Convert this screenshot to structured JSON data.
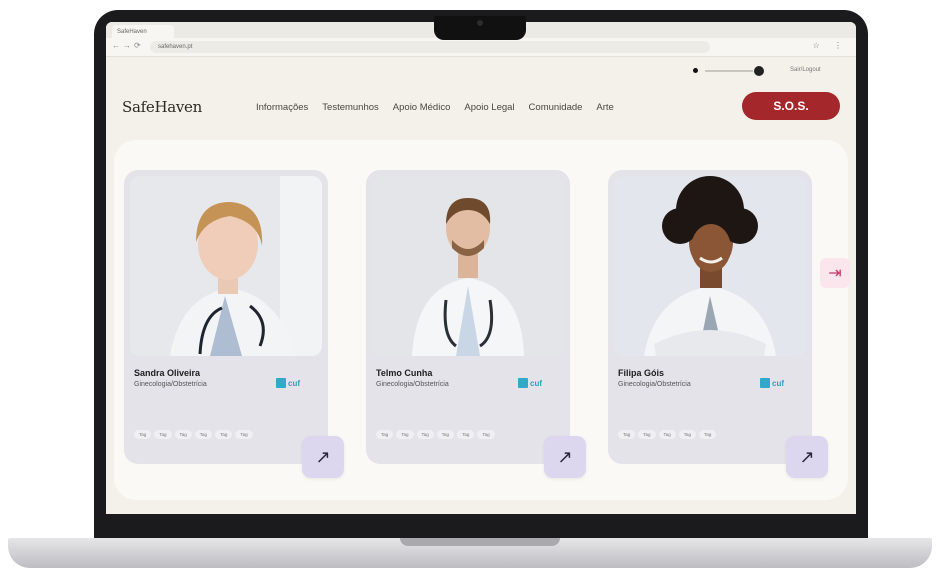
{
  "browser": {
    "tab_title": "SafeHaven",
    "url": "safehaven.pt",
    "back": "←",
    "forward": "→",
    "reload": "⟳",
    "icons": "☆ ⋮"
  },
  "header": {
    "logo": "SafeHaven",
    "nav": [
      "Informações",
      "Testemunhos",
      "Apoio Médico",
      "Apoio Legal",
      "Comunidade",
      "Arte"
    ],
    "sos": "S.O.S.",
    "signout": "Sair/Logout"
  },
  "doctors": [
    {
      "name": "Sandra Oliveira",
      "role": "Ginecologia/Obstetrícia",
      "tags": [
        "Tag",
        "Tag",
        "Tag",
        "Tag",
        "Tag",
        "Tag"
      ],
      "logo_text": "cuf"
    },
    {
      "name": "Telmo Cunha",
      "role": "Ginecologia/Obstetrícia",
      "tags": [
        "Tag",
        "Tag",
        "Tag",
        "Tag",
        "Tag",
        "Tag"
      ],
      "logo_text": "cuf"
    },
    {
      "name": "Filipa Góis",
      "role": "Ginecologia/Obstetrícia",
      "tags": [
        "Tag",
        "Tag",
        "Tag",
        "Tag",
        "Tag"
      ],
      "logo_text": "cuf"
    }
  ],
  "icons": {
    "arrow": "arrow-up-right-icon",
    "exit": "exit-icon"
  },
  "colors": {
    "sos": "#a3272b",
    "arrow_button": "#dcd7ee",
    "card": "#e5e3ea",
    "cuf": "#33a9c9"
  }
}
